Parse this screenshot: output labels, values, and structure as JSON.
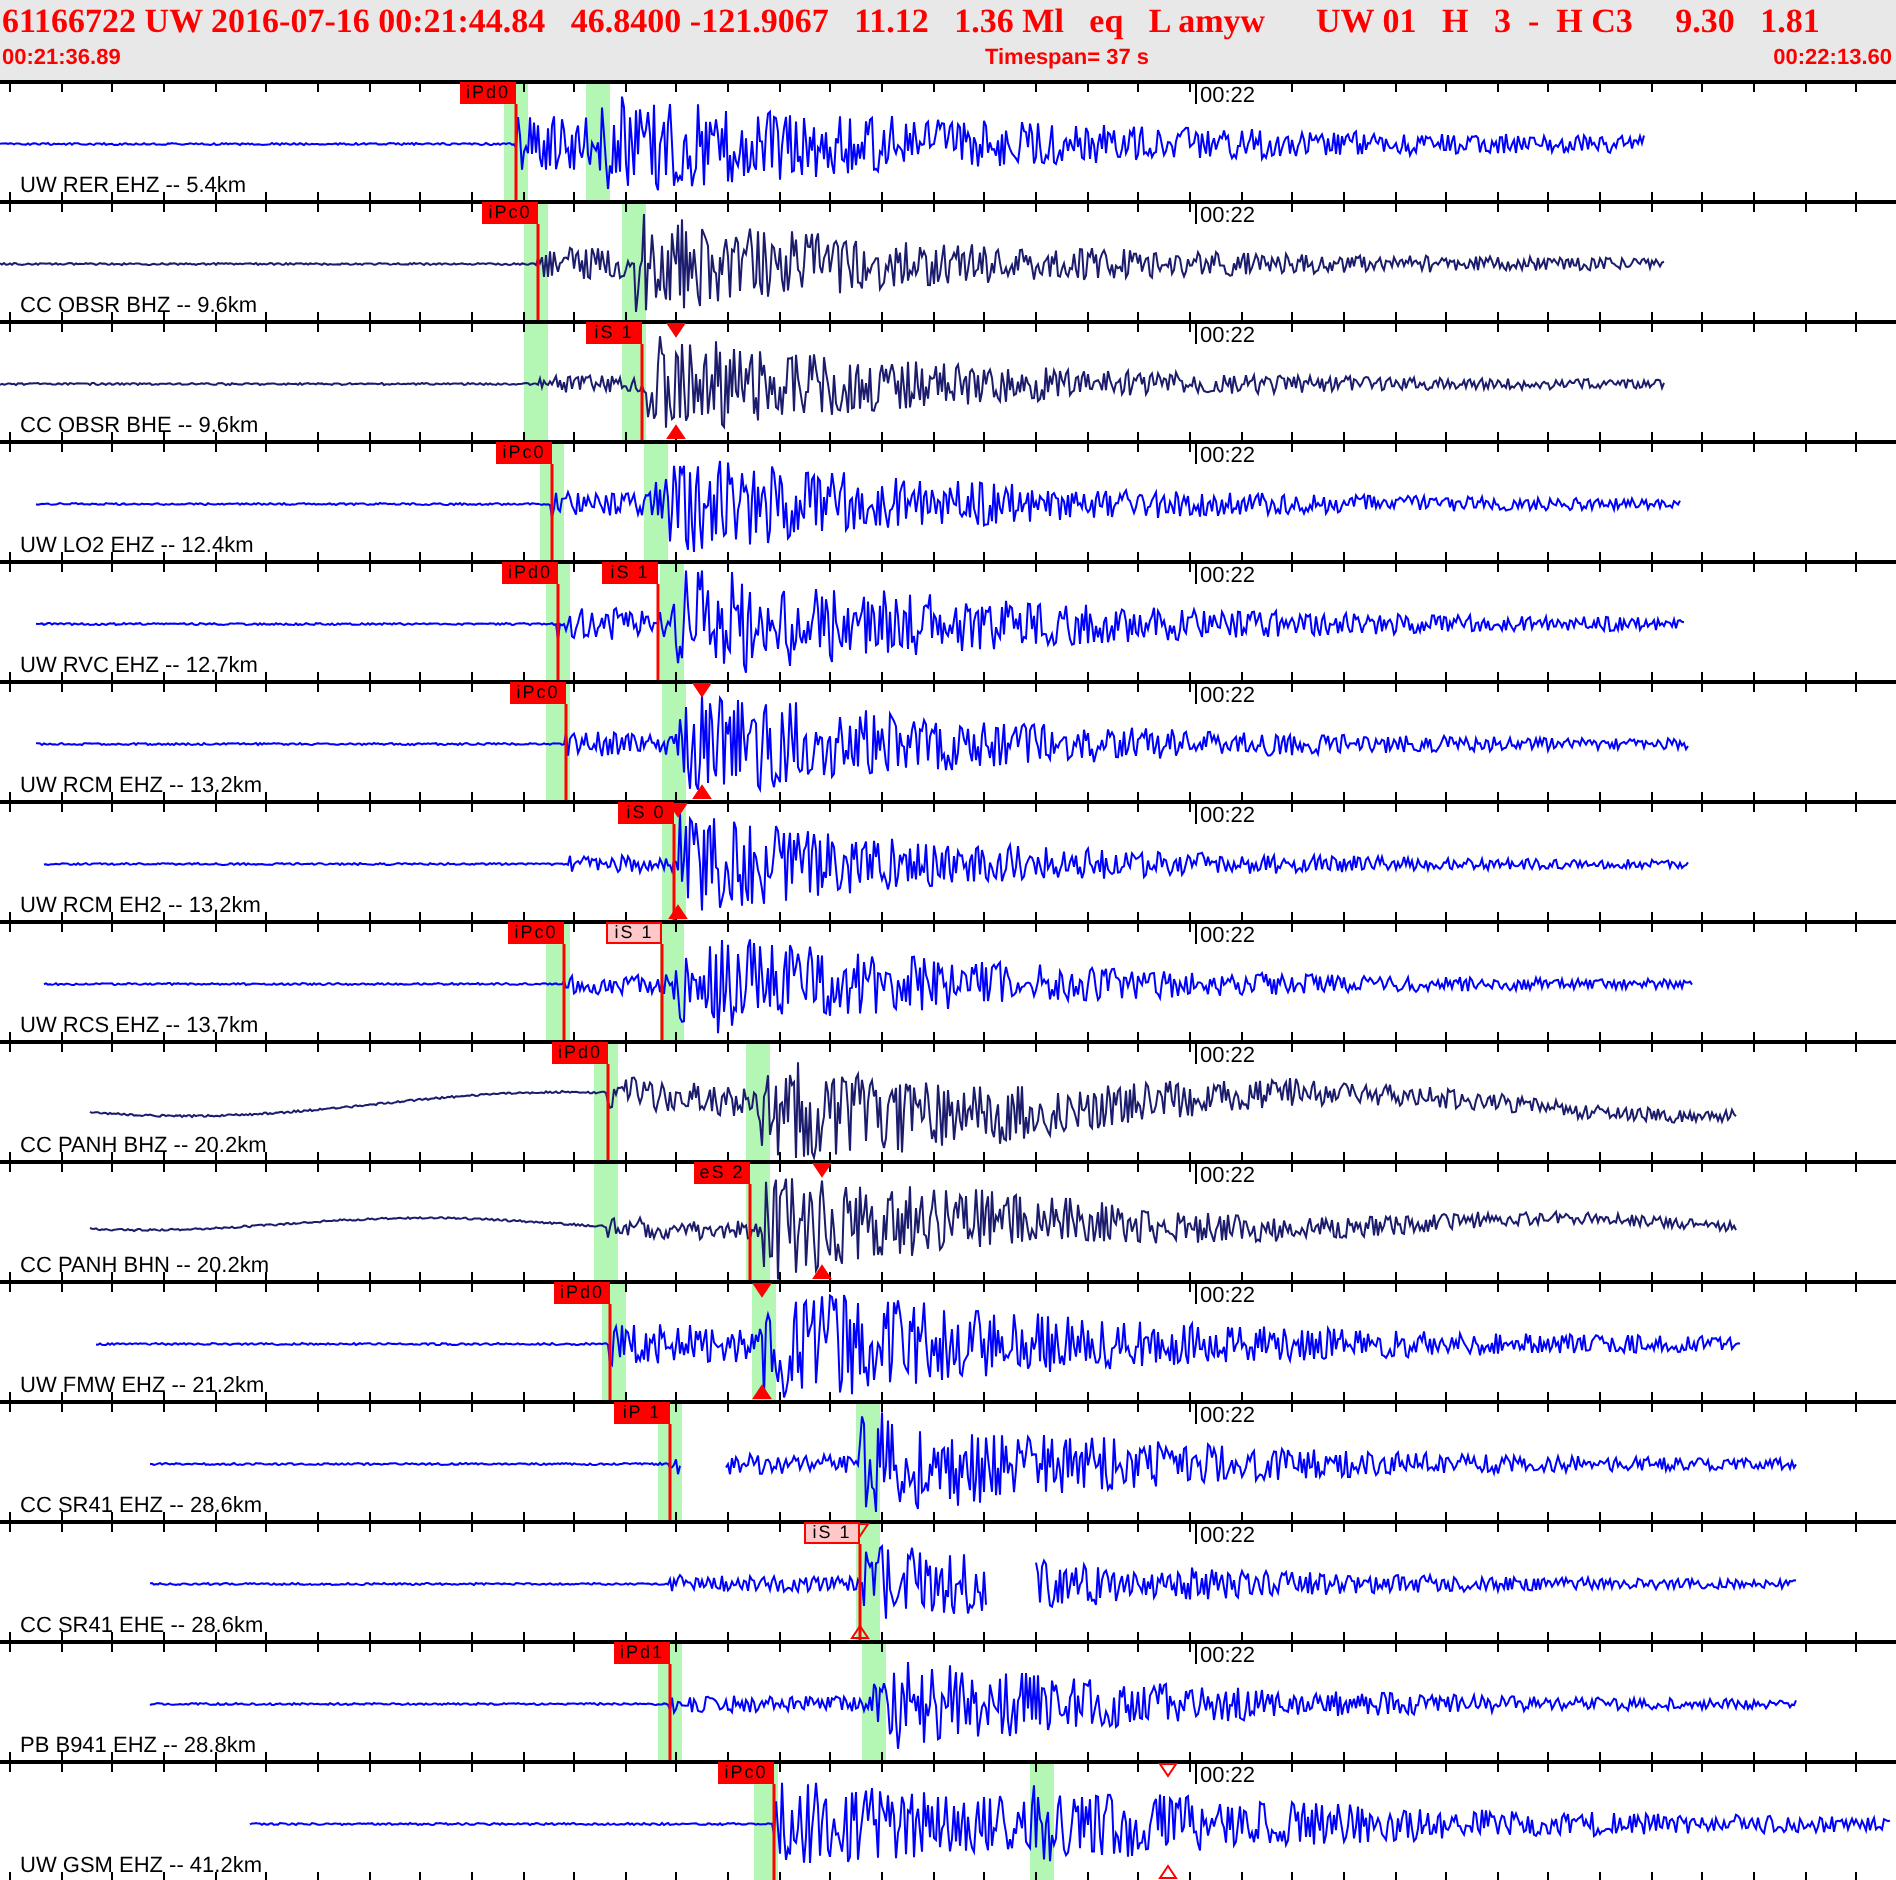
{
  "header": {
    "event_line": "61166722 UW 2016-07-16 00:21:44.84   46.8400 -121.9067   11.12   1.36 Ml   eq   L amyw      UW 01   H   3  -  H C3     9.30   1.81",
    "start_time": "00:21:36.89",
    "timespan": "Timespan=  37 s",
    "end_time": "00:22:13.60"
  },
  "traces": [
    {
      "station": "UW RER EHZ -- 5.4km",
      "time_label": "00:22",
      "color": "#0000ff",
      "picks": [
        {
          "label": "iPd0",
          "kind": "strong"
        }
      ]
    },
    {
      "station": "CC OBSR BHZ -- 9.6km",
      "time_label": "00:22",
      "color": "#1c1c6c",
      "picks": [
        {
          "label": "iPc0",
          "kind": "strong"
        }
      ]
    },
    {
      "station": "CC OBSR BHE -- 9.6km",
      "time_label": "00:22",
      "color": "#1c1c6c",
      "picks": [
        {
          "label": "iS 1",
          "kind": "strong"
        }
      ]
    },
    {
      "station": "UW LO2 EHZ -- 12.4km",
      "time_label": "00:22",
      "color": "#0000ff",
      "picks": [
        {
          "label": "iPc0",
          "kind": "strong"
        }
      ]
    },
    {
      "station": "UW RVC EHZ -- 12.7km",
      "time_label": "00:22",
      "color": "#0000ff",
      "picks": [
        {
          "label": "iPd0",
          "kind": "strong"
        },
        {
          "label": "iS 1",
          "kind": "strong"
        }
      ]
    },
    {
      "station": "UW RCM EHZ -- 13.2km",
      "time_label": "00:22",
      "color": "#0000ff",
      "picks": [
        {
          "label": "iPc0",
          "kind": "strong"
        }
      ]
    },
    {
      "station": "UW RCM EH2 -- 13.2km",
      "time_label": "00:22",
      "color": "#0000ff",
      "picks": [
        {
          "label": "iS 0",
          "kind": "strong"
        }
      ]
    },
    {
      "station": "UW RCS EHZ -- 13.7km",
      "time_label": "00:22",
      "color": "#0000ff",
      "picks": [
        {
          "label": "iPc0",
          "kind": "strong"
        },
        {
          "label": "iS 1",
          "kind": "weak"
        }
      ]
    },
    {
      "station": "CC PANH BHZ -- 20.2km",
      "time_label": "00:22",
      "color": "#1c1c6c",
      "picks": [
        {
          "label": "iPd0",
          "kind": "strong"
        }
      ]
    },
    {
      "station": "CC PANH BHN -- 20.2km",
      "time_label": "00:22",
      "color": "#1c1c6c",
      "picks": [
        {
          "label": "eS 2",
          "kind": "strong"
        }
      ]
    },
    {
      "station": "UW FMW EHZ -- 21.2km",
      "time_label": "00:22",
      "color": "#0000ff",
      "picks": [
        {
          "label": "iPd0",
          "kind": "strong"
        }
      ]
    },
    {
      "station": "CC SR41 EHZ -- 28.6km",
      "time_label": "00:22",
      "color": "#0000ff",
      "picks": [
        {
          "label": "iP 1",
          "kind": "strong"
        }
      ]
    },
    {
      "station": "CC SR41 EHE -- 28.6km",
      "time_label": "00:22",
      "color": "#0000ff",
      "picks": [
        {
          "label": "iS 1",
          "kind": "weak"
        }
      ]
    },
    {
      "station": "PB B941 EHZ -- 28.8km",
      "time_label": "00:22",
      "color": "#0000ff",
      "picks": [
        {
          "label": "iPd1",
          "kind": "strong"
        }
      ]
    },
    {
      "station": "UW GSM EHZ -- 41.2km",
      "time_label": "00:22",
      "color": "#0000ff",
      "picks": [
        {
          "label": "iPc0",
          "kind": "strong"
        }
      ]
    }
  ]
}
